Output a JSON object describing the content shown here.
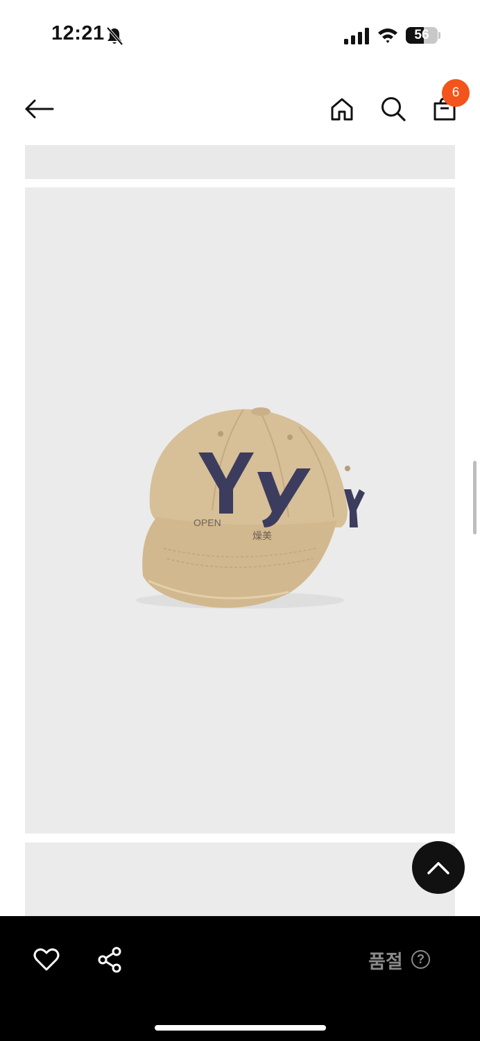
{
  "status_bar": {
    "time": "12:21",
    "battery_level": "56",
    "battery_fraction": 0.56
  },
  "nav": {
    "cart_count": "6"
  },
  "bottom_bar": {
    "status_label": "품절",
    "help_symbol": "?"
  },
  "colors": {
    "badge": "#f2541b",
    "bottom_bar": "#000000",
    "image_bg": "#ebebeb"
  },
  "icons": {
    "back": "arrow-left-icon",
    "home": "home-icon",
    "search": "search-icon",
    "cart": "shopping-bag-icon",
    "scroll_top": "chevron-up-icon",
    "wishlist": "heart-icon",
    "share": "share-icon"
  }
}
